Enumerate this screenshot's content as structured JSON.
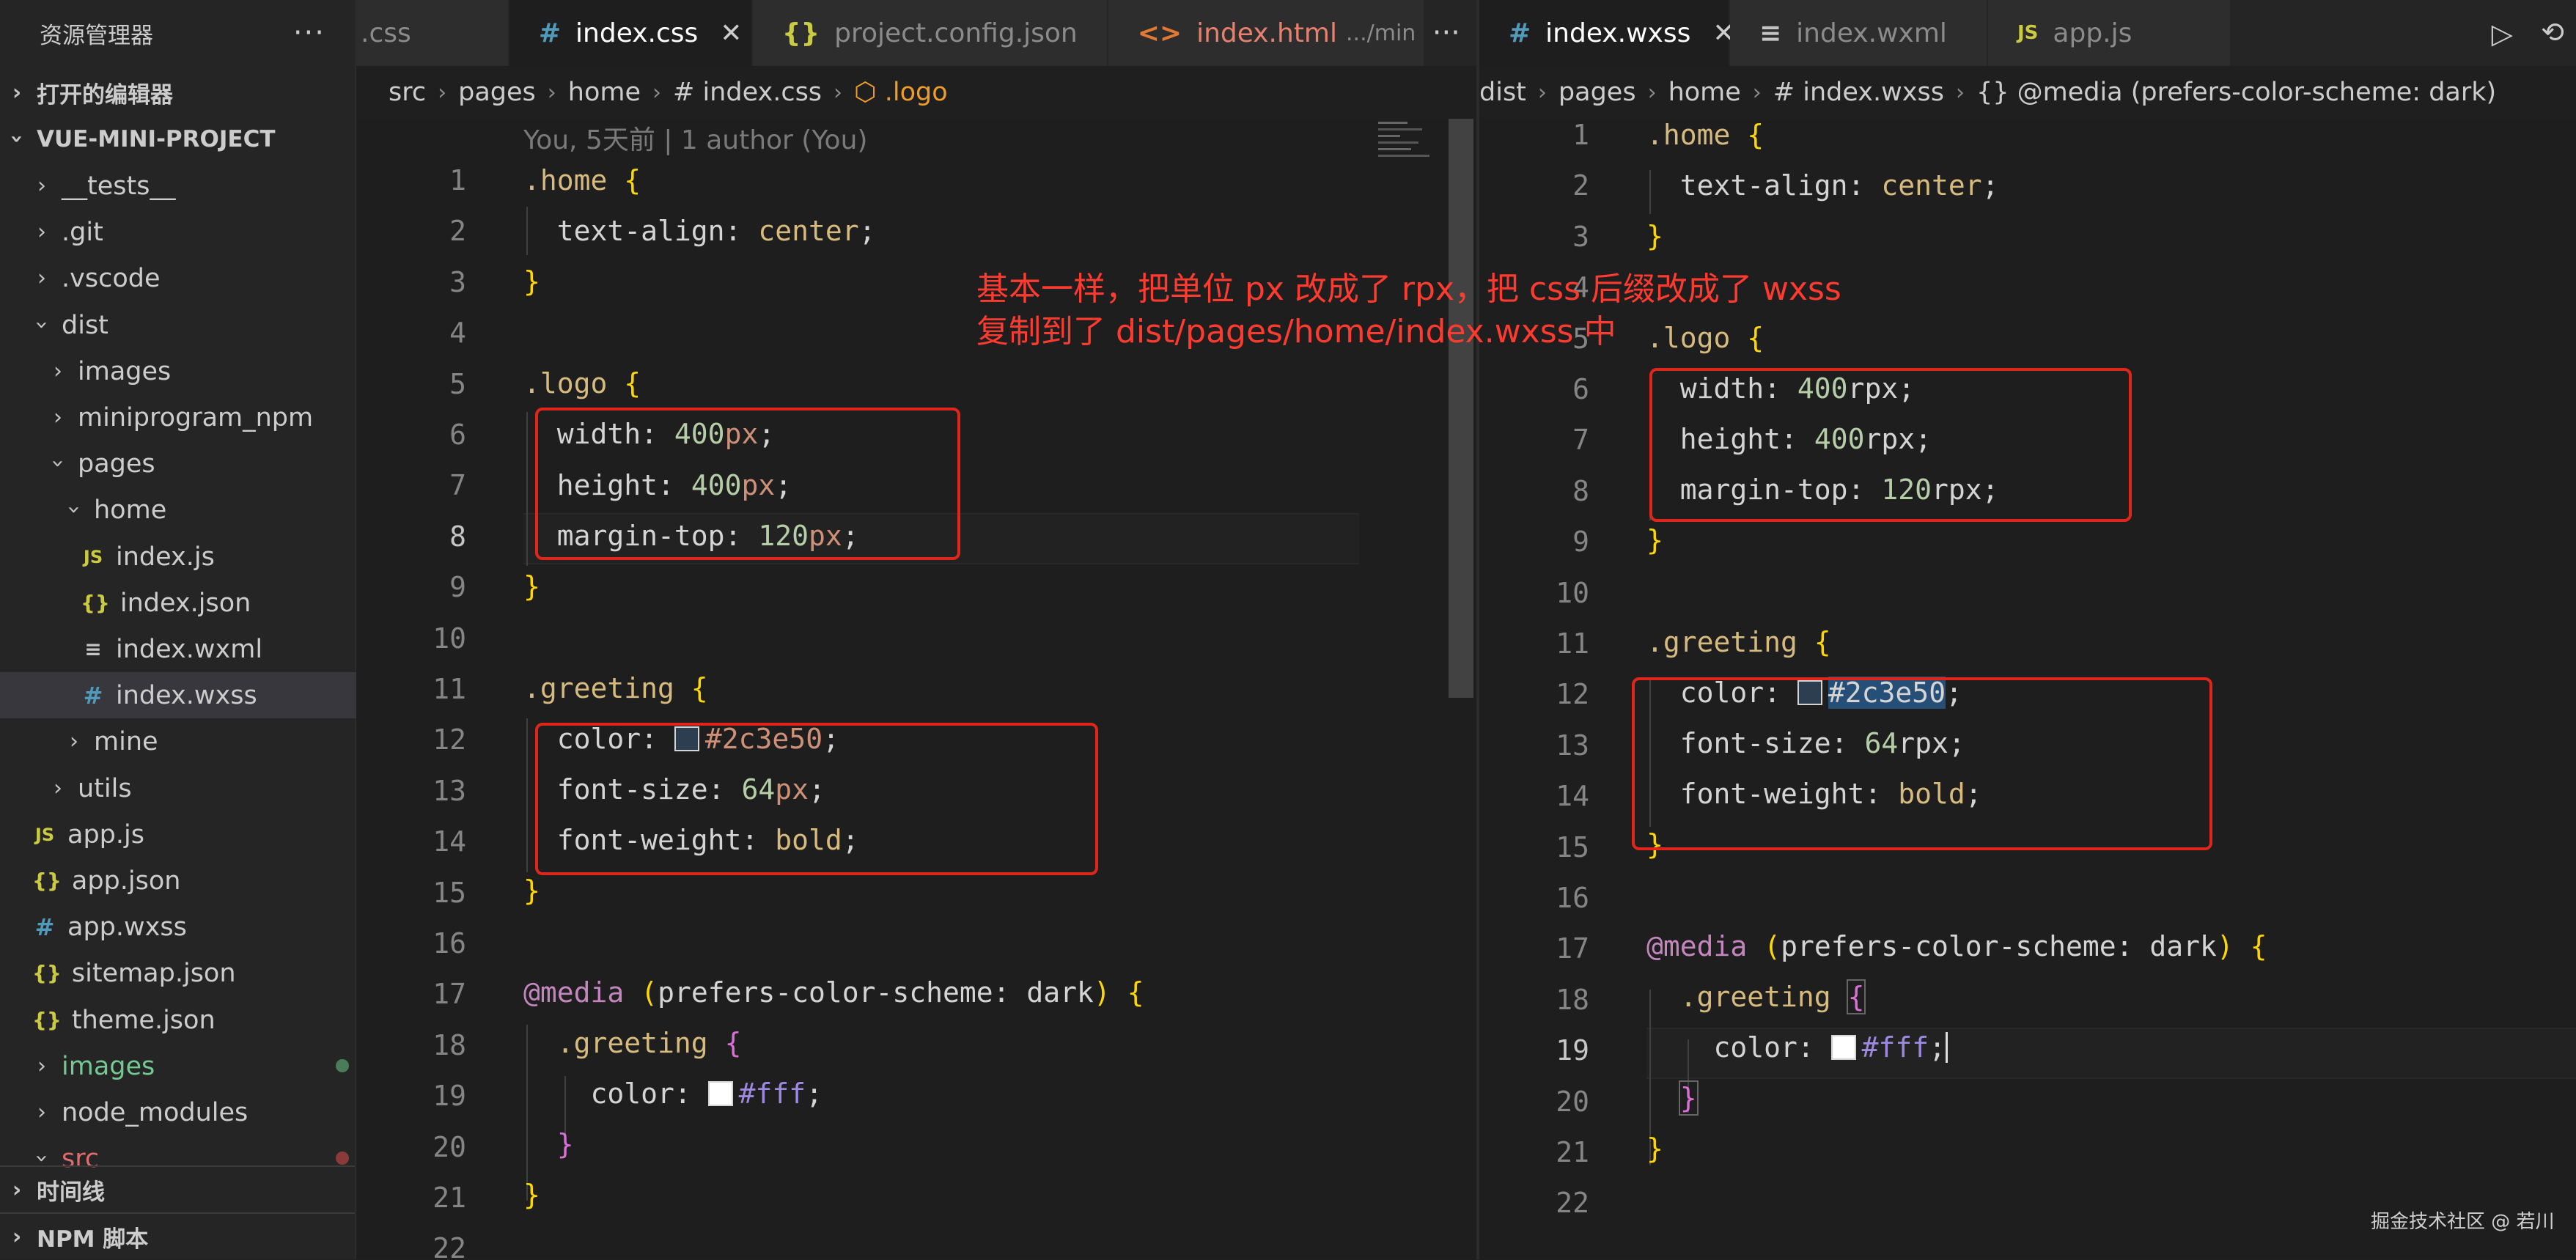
{
  "sidebar": {
    "title": "资源管理器",
    "more": "···",
    "open_editors": "打开的编辑器",
    "project": "VUE-MINI-PROJECT",
    "items": [
      {
        "label": "__tests__",
        "type": "folder",
        "open": false
      },
      {
        "label": ".git",
        "type": "folder",
        "open": false
      },
      {
        "label": ".vscode",
        "type": "folder",
        "open": false
      },
      {
        "label": "dist",
        "type": "folder",
        "open": true
      },
      {
        "label": "images",
        "type": "folder",
        "open": false
      },
      {
        "label": "miniprogram_npm",
        "type": "folder",
        "open": false
      },
      {
        "label": "pages",
        "type": "folder",
        "open": true
      },
      {
        "label": "home",
        "type": "folder",
        "open": true
      },
      {
        "label": "index.js",
        "type": "js"
      },
      {
        "label": "index.json",
        "type": "json"
      },
      {
        "label": "index.wxml",
        "type": "wxml"
      },
      {
        "label": "index.wxss",
        "type": "wxss",
        "selected": true
      },
      {
        "label": "mine",
        "type": "folder",
        "open": false
      },
      {
        "label": "utils",
        "type": "folder",
        "open": false
      },
      {
        "label": "app.js",
        "type": "js"
      },
      {
        "label": "app.json",
        "type": "json"
      },
      {
        "label": "app.wxss",
        "type": "wxss"
      },
      {
        "label": "sitemap.json",
        "type": "json"
      },
      {
        "label": "theme.json",
        "type": "json"
      },
      {
        "label": "images",
        "type": "folder",
        "open": false,
        "status": "green"
      },
      {
        "label": "node_modules",
        "type": "folder",
        "open": false
      },
      {
        "label": "src",
        "type": "folder",
        "open": true,
        "status": "red"
      }
    ],
    "timeline": "时间线",
    "npm_scripts": "NPM 脚本"
  },
  "left_editor": {
    "tabs": [
      {
        "label": ".css",
        "icon": ""
      },
      {
        "label": "index.css",
        "icon": "#",
        "active": true,
        "close": "✕"
      },
      {
        "label": "project.config.json",
        "icon": "{}"
      },
      {
        "label": "index.html",
        "icon": "<>",
        "desc": ".../min"
      }
    ],
    "more": "···",
    "breadcrumb": [
      "src",
      "pages",
      "home",
      "# index.css",
      "⬡ .logo"
    ],
    "blame": "You, 5天前 | 1 author (You)",
    "line_numbers": [
      "1",
      "2",
      "3",
      "4",
      "5",
      "6",
      "7",
      "8",
      "9",
      "10",
      "11",
      "12",
      "13",
      "14",
      "15",
      "16",
      "17",
      "18",
      "19",
      "20",
      "21",
      "22"
    ],
    "current_line": "8"
  },
  "right_editor": {
    "tabs": [
      {
        "label": "index.wxss",
        "icon": "#",
        "active": true,
        "close": "✕"
      },
      {
        "label": "index.wxml",
        "icon": "≡"
      },
      {
        "label": "app.js",
        "icon": "JS"
      }
    ],
    "breadcrumb": [
      "dist",
      "pages",
      "home",
      "# index.wxss",
      "{} @media (prefers-color-scheme: dark)"
    ],
    "line_numbers": [
      "1",
      "2",
      "3",
      "4",
      "5",
      "6",
      "7",
      "8",
      "9",
      "10",
      "11",
      "12",
      "13",
      "14",
      "15",
      "16",
      "17",
      "18",
      "19",
      "20",
      "21",
      "22"
    ],
    "current_line": "19"
  },
  "annotation": {
    "line1": "基本一样，把单位 px 改成了 rpx，把 css 后缀改成了 wxss",
    "line2": "复制到了 dist/pages/home/index.wxss 中"
  },
  "watermark": "掘金技术社区 @ 若川",
  "colors": {
    "annotation": "#ff3b30",
    "box": "#e0261b",
    "swatch_dark": "#2c3e50",
    "swatch_light": "#ffffff"
  }
}
